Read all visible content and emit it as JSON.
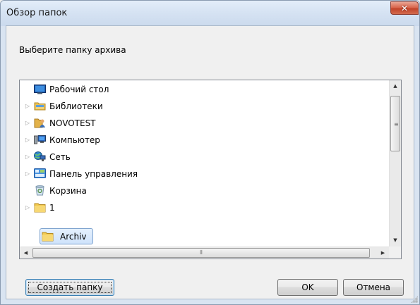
{
  "window": {
    "title": "Обзор папок",
    "close_label": "✕"
  },
  "dialog": {
    "prompt": "Выберите папку архива"
  },
  "tree": {
    "items": [
      {
        "label": "Рабочий стол",
        "icon": "desktop-icon",
        "expander": false
      },
      {
        "label": "Библиотеки",
        "icon": "libraries-icon",
        "expander": true
      },
      {
        "label": "NOVOTEST",
        "icon": "user-folder-icon",
        "expander": true
      },
      {
        "label": "Компьютер",
        "icon": "computer-icon",
        "expander": true
      },
      {
        "label": "Сеть",
        "icon": "network-icon",
        "expander": true
      },
      {
        "label": "Панель управления",
        "icon": "control-panel-icon",
        "expander": true
      },
      {
        "label": "Корзина",
        "icon": "recycle-bin-icon",
        "expander": false
      },
      {
        "label": "1",
        "icon": "folder-icon",
        "expander": true
      },
      {
        "label": "Archiv",
        "icon": "folder-icon",
        "expander": false,
        "selected": true
      }
    ]
  },
  "buttons": {
    "new_folder": "Создать папку",
    "ok": "OK",
    "cancel": "Отмена"
  }
}
